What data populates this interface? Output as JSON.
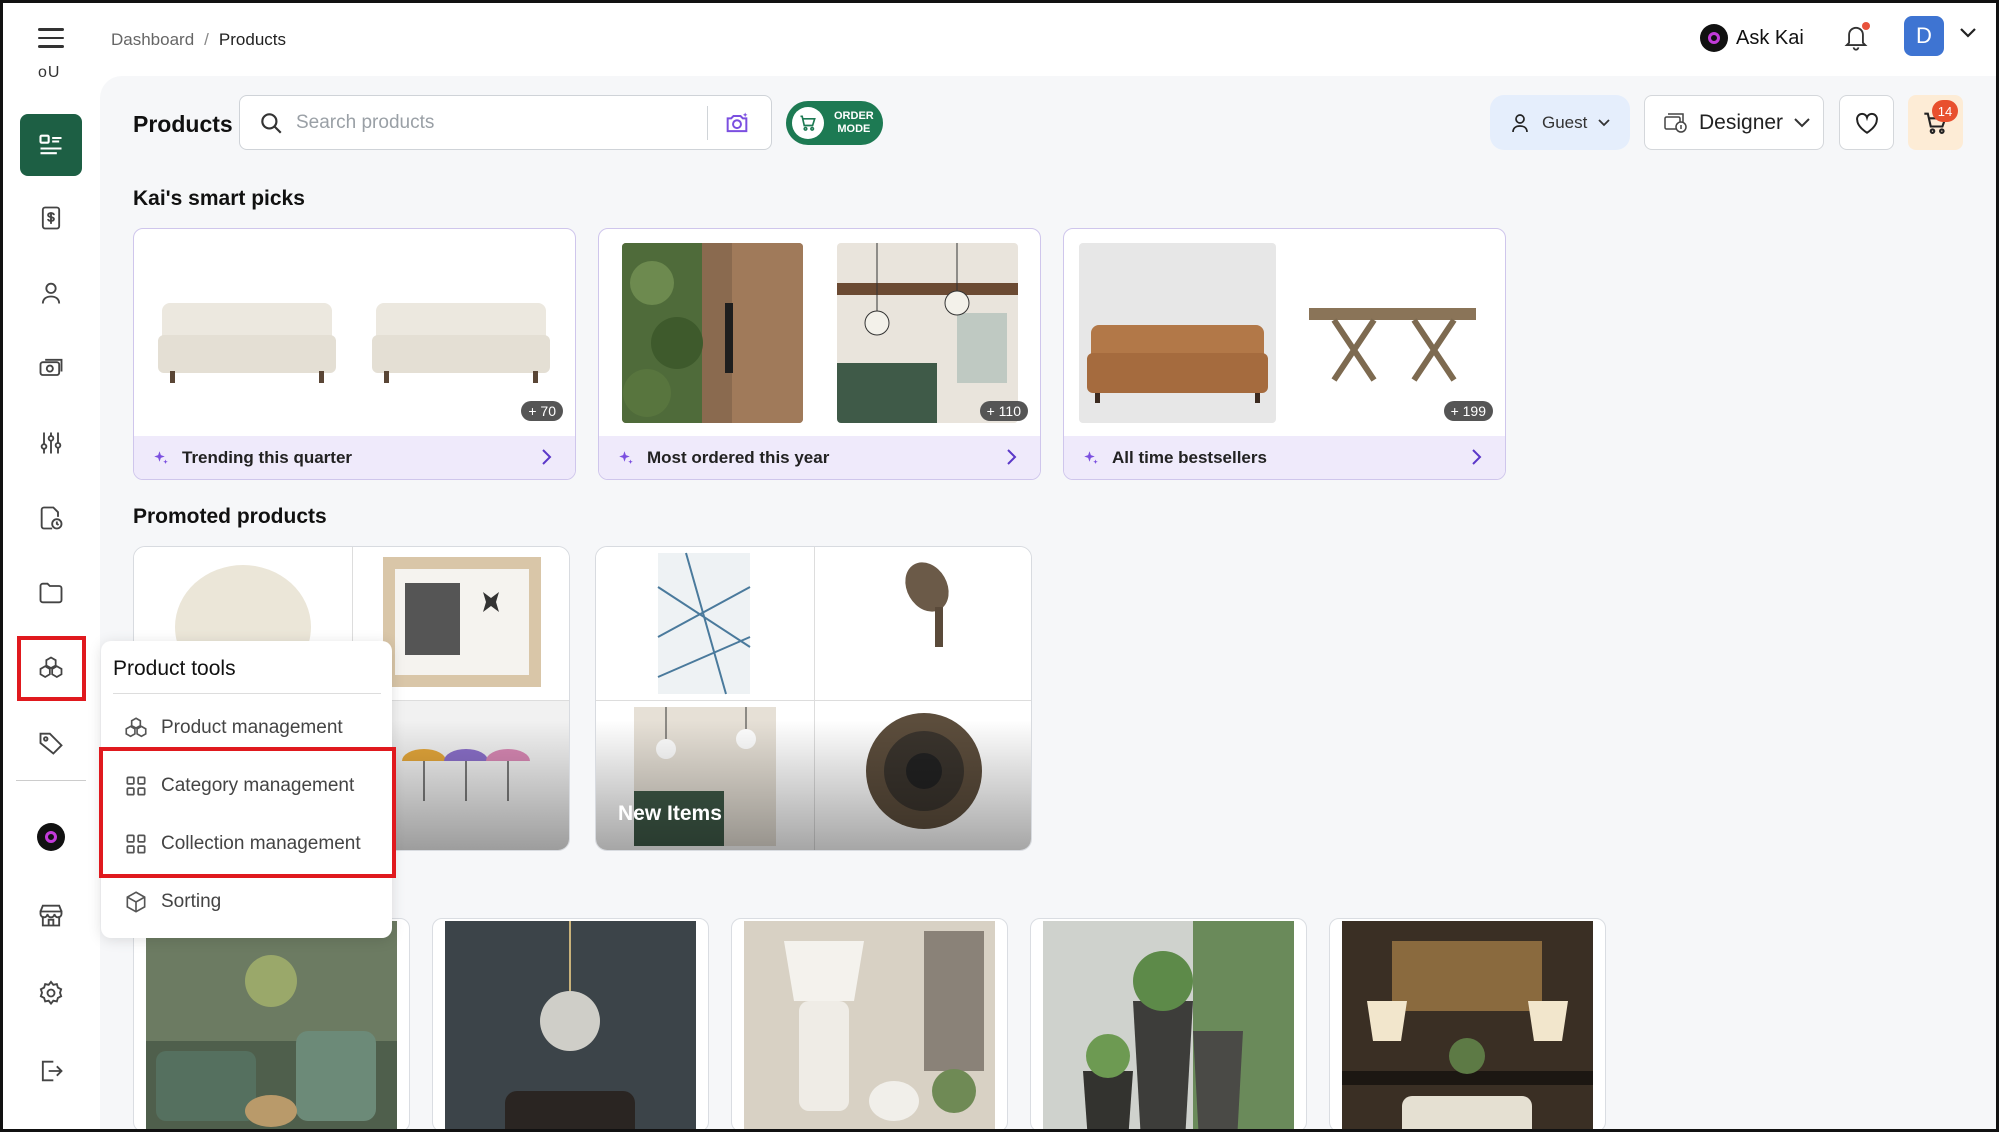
{
  "topbar": {
    "breadcrumb": [
      "Dashboard",
      "Products"
    ],
    "ask_kai_label": "Ask Kai",
    "avatar_initial": "D"
  },
  "sidebar": {
    "top_text": "oU",
    "items": [
      {
        "icon": "product-list-icon",
        "active": true
      },
      {
        "icon": "invoice-dollar-icon"
      },
      {
        "icon": "user-icon"
      },
      {
        "icon": "money-camera-icon"
      },
      {
        "icon": "sliders-icon"
      },
      {
        "icon": "document-clock-icon"
      },
      {
        "icon": "folder-icon"
      },
      {
        "icon": "product-tools-icon",
        "highlighted": true
      },
      {
        "icon": "tag-icon"
      },
      {
        "icon": "kai-logo-icon"
      },
      {
        "icon": "store-icon"
      },
      {
        "icon": "settings-gear-icon"
      },
      {
        "icon": "logout-icon"
      }
    ]
  },
  "header": {
    "title": "Products",
    "search_placeholder": "Search products",
    "order_mode_line1": "ORDER",
    "order_mode_line2": "MODE",
    "guest_label": "Guest",
    "designer_label": "Designer",
    "cart_count": "14"
  },
  "smart_picks": {
    "title": "Kai's smart picks",
    "cards": [
      {
        "label": "Trending this quarter",
        "count": "+ 70"
      },
      {
        "label": "Most ordered this year",
        "count": "+ 110"
      },
      {
        "label": "All time bestsellers",
        "count": "+ 199"
      }
    ]
  },
  "promoted": {
    "title": "Promoted products",
    "cards": [
      {
        "label": ""
      },
      {
        "label": "New Items"
      }
    ]
  },
  "product_tools_menu": {
    "title": "Product tools",
    "items": [
      {
        "label": "Product management",
        "icon": "product-tools-icon"
      },
      {
        "label": "Category management",
        "icon": "grid-icon"
      },
      {
        "label": "Collection management",
        "icon": "grid-icon"
      },
      {
        "label": "Sorting",
        "icon": "cube-icon"
      }
    ]
  },
  "colors": {
    "brand_green": "#1d5f44",
    "order_mode_green": "#1d7a53",
    "highlight_red": "#e0191e",
    "avatar_blue": "#3e74d2",
    "smart_pick_footer": "#efeafb"
  }
}
